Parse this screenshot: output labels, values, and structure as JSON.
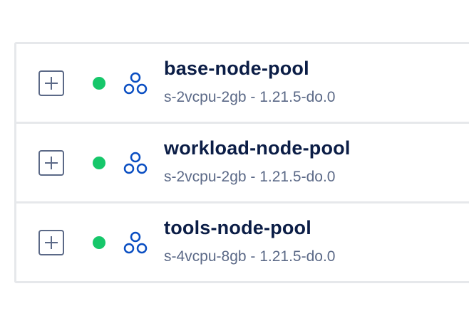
{
  "colors": {
    "status_ok": "#16c76a",
    "title": "#0b1d46",
    "meta": "#5b6987",
    "icon_stroke": "#0a4ec2",
    "border": "#e6e8eb"
  },
  "node_pools": [
    {
      "name": "base-node-pool",
      "meta": "s-2vcpu-2gb - 1.21.5-do.0",
      "status": "running",
      "icon": "node-pool-icon"
    },
    {
      "name": "workload-node-pool",
      "meta": "s-2vcpu-2gb - 1.21.5-do.0",
      "status": "running",
      "icon": "node-pool-icon"
    },
    {
      "name": "tools-node-pool",
      "meta": "s-4vcpu-8gb - 1.21.5-do.0",
      "status": "running",
      "icon": "node-pool-icon"
    }
  ]
}
